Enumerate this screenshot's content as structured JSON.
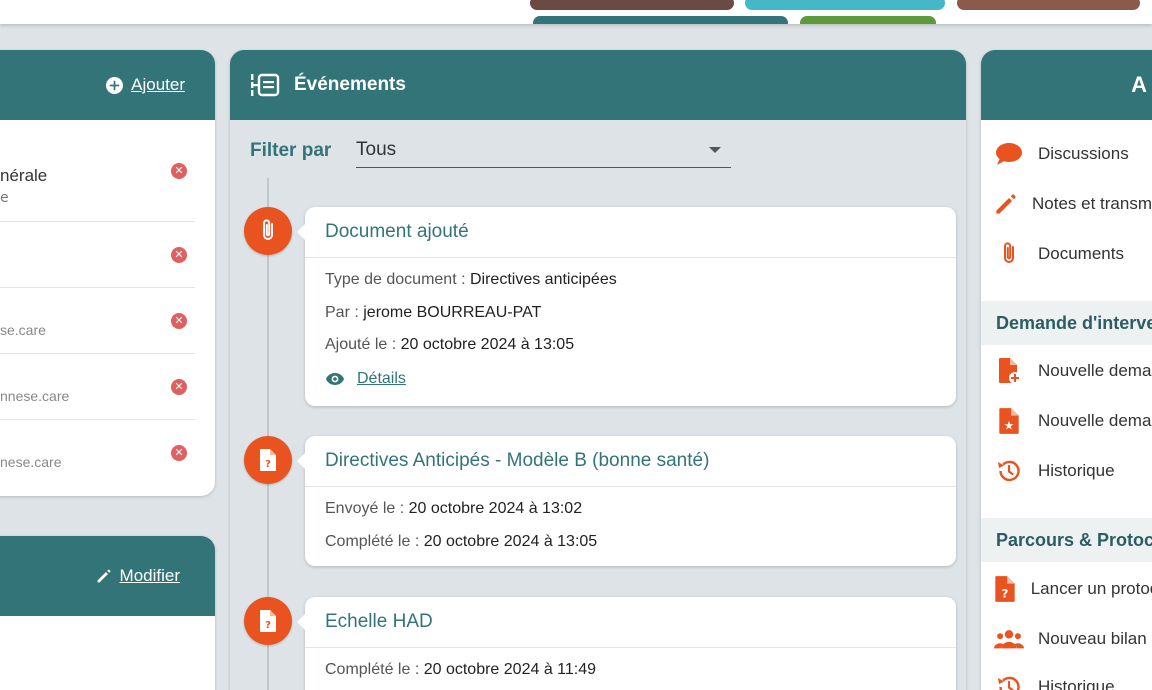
{
  "participants": {
    "add_label": "Ajouter",
    "items": [
      {
        "line1": "nérale",
        "line2": "e"
      },
      {
        "line1": "",
        "line2": ""
      },
      {
        "email": "se.care"
      },
      {
        "email": "nnese.care"
      },
      {
        "email": "nese.care"
      }
    ]
  },
  "info_panel": {
    "edit_label": "Modifier"
  },
  "events": {
    "title": "Événements",
    "filter_label": "Filter par",
    "filter_value": "Tous",
    "cards": [
      {
        "title": "Document ajouté",
        "rows": [
          {
            "key": "Type de document : ",
            "value": "Directives anticipées"
          },
          {
            "key": "Par : ",
            "value": "jerome BOURREAU-PAT"
          },
          {
            "key": "Ajouté le : ",
            "value": "20 octobre 2024 à 13:05"
          }
        ],
        "details_label": "Détails"
      },
      {
        "title": "Directives Anticipés - Modèle B (bonne santé)",
        "rows": [
          {
            "key": "Envoyé le : ",
            "value": "20 octobre 2024 à 13:02"
          },
          {
            "key": "Complété le : ",
            "value": "20 octobre 2024 à 13:05"
          }
        ]
      },
      {
        "title": "Echelle HAD",
        "rows": [
          {
            "key": "Complété le : ",
            "value": "20 octobre 2024 à 11:49"
          }
        ]
      }
    ]
  },
  "actions": {
    "header_letter": "A",
    "items": [
      {
        "label": "Discussions",
        "icon": "chat-bubble-icon"
      },
      {
        "label": "Notes et transmissions",
        "icon": "pencil-icon"
      },
      {
        "label": "Documents",
        "icon": "paperclip-icon"
      }
    ],
    "section_demande": "Demande d'intervention",
    "demande_items": [
      {
        "label": "Nouvelle demande",
        "icon": "file-plus-icon"
      },
      {
        "label": "Nouvelle demande",
        "icon": "file-star-icon"
      },
      {
        "label": "Historique",
        "icon": "history-icon"
      }
    ],
    "section_parcours": "Parcours & Protocoles",
    "parcours_items": [
      {
        "label": "Lancer un protocole",
        "icon": "file-question-icon"
      },
      {
        "label": "Nouveau bilan",
        "icon": "users-icon"
      },
      {
        "label": "Historique",
        "icon": "history-icon"
      }
    ]
  },
  "colors": {
    "header": "#337479",
    "accent": "#e8531f",
    "remove": "#e06060",
    "background": "#dde3e6"
  }
}
